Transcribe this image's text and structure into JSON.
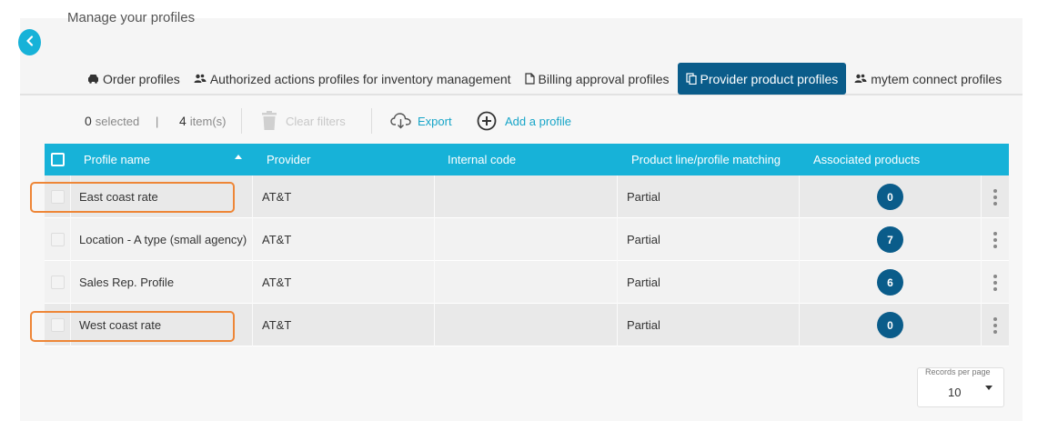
{
  "page": {
    "title": "Manage your profiles"
  },
  "tabs": [
    {
      "label": "Order profiles",
      "icon": "car-icon"
    },
    {
      "label": "Authorized actions profiles for inventory management",
      "icon": "users-icon"
    },
    {
      "label": "Billing approval profiles",
      "icon": "document-icon"
    },
    {
      "label": "Provider product profiles",
      "icon": "copy-icon",
      "active": true
    },
    {
      "label": "mytem connect profiles",
      "icon": "users-icon"
    }
  ],
  "toolbar": {
    "selected_count": "0",
    "selected_label": "selected",
    "separator": "|",
    "item_count": "4",
    "item_label": "item(s)",
    "clear_filters": "Clear filters",
    "export": "Export",
    "add_profile": "Add a profile"
  },
  "table": {
    "columns": [
      "Profile name",
      "Provider",
      "Internal code",
      "Product line/profile matching",
      "Associated products"
    ],
    "rows": [
      {
        "name": "East coast rate",
        "provider": "AT&T",
        "internal_code": "",
        "matching": "Partial",
        "associated": "0"
      },
      {
        "name": "Location - A type (small agency)",
        "provider": "AT&T",
        "internal_code": "",
        "matching": "Partial",
        "associated": "7"
      },
      {
        "name": "Sales Rep. Profile",
        "provider": "AT&T",
        "internal_code": "",
        "matching": "Partial",
        "associated": "6"
      },
      {
        "name": "West coast rate",
        "provider": "AT&T",
        "internal_code": "",
        "matching": "Partial",
        "associated": "0"
      }
    ]
  },
  "pagination": {
    "records_per_page_label": "Records per page",
    "records_per_page": "10"
  },
  "colors": {
    "accent": "#17b2d8",
    "primary": "#0a5c8a",
    "highlight": "#ee8637"
  }
}
